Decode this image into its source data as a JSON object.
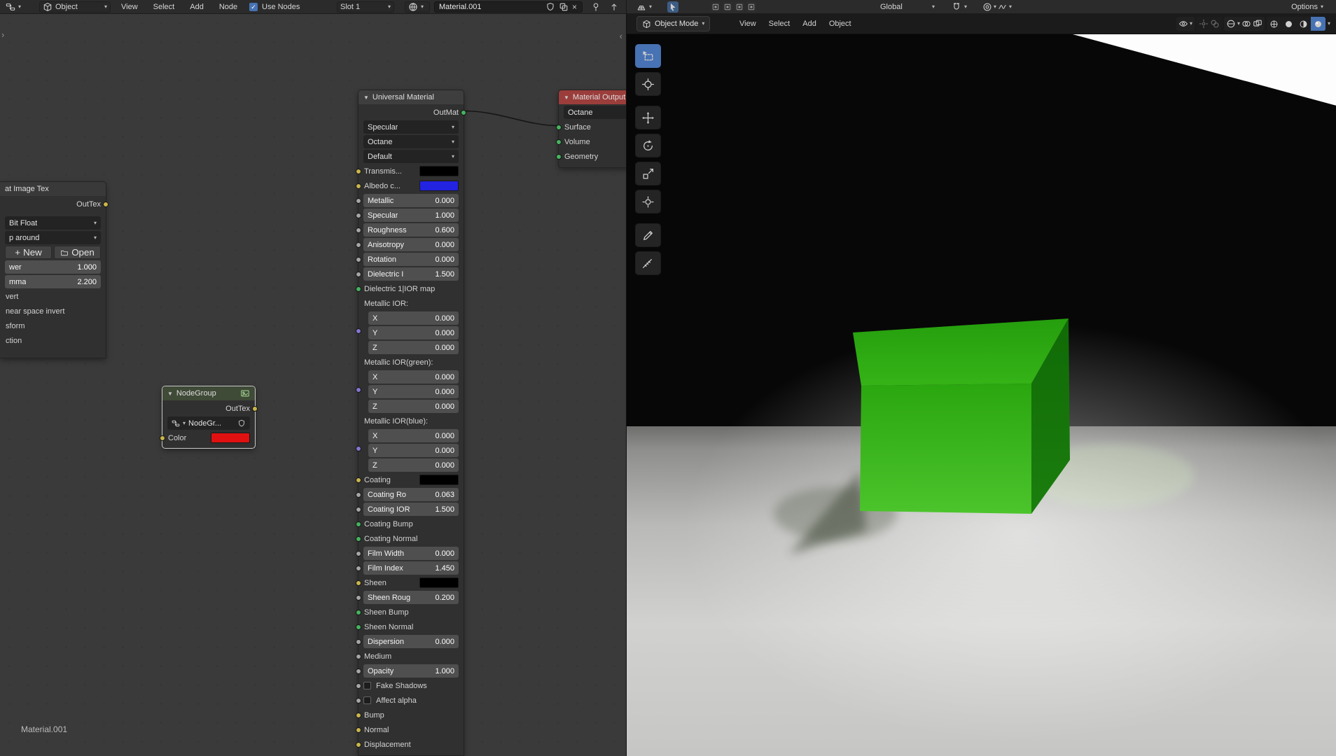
{
  "topbar": {
    "shader_type_label": "Object",
    "menus": [
      "View",
      "Select",
      "Add",
      "Node"
    ],
    "use_nodes_label": "Use Nodes",
    "use_nodes_checked": true,
    "slot_label": "Slot 1",
    "material_name": "Material.001",
    "right": {
      "orientation_label": "Global",
      "options_label": "Options"
    }
  },
  "viewport": {
    "header": {
      "mode_label": "Object Mode",
      "menus": [
        "View",
        "Select",
        "Add",
        "Object"
      ],
      "shading_modes": [
        {
          "name": "wireframe",
          "active": false
        },
        {
          "name": "solid",
          "active": false
        },
        {
          "name": "material-preview",
          "active": false
        },
        {
          "name": "rendered",
          "active": true
        }
      ]
    },
    "tools": [
      {
        "name": "select-box",
        "active": true
      },
      {
        "name": "cursor",
        "active": false
      },
      {
        "name": "move",
        "active": false
      },
      {
        "name": "rotate",
        "active": false
      },
      {
        "name": "scale",
        "active": false
      },
      {
        "name": "transform",
        "active": false
      },
      {
        "name": "annotate",
        "active": false
      },
      {
        "name": "measure",
        "active": false
      }
    ],
    "scene": {
      "object": "green-cube",
      "object_color": "#35b117",
      "floor_color": "#c9c9c7",
      "light_color": "#fdfdfd"
    }
  },
  "node_editor": {
    "tree_path_label": "Material.001",
    "nodes": {
      "image_tex": {
        "title": "at Image Tex",
        "output_label": "OutTex",
        "rows": [
          {
            "kind": "dropdown",
            "label": "Bit Float"
          },
          {
            "kind": "dropdown",
            "label": "p around"
          },
          {
            "kind": "buttons",
            "labels": [
              "New",
              "Open"
            ]
          },
          {
            "kind": "slider",
            "label": "wer",
            "value": "1.000"
          },
          {
            "kind": "slider",
            "label": "mma",
            "value": "2.200"
          },
          {
            "kind": "label",
            "label": "vert"
          },
          {
            "kind": "label",
            "label": "near space invert"
          },
          {
            "kind": "label",
            "label": "sform"
          },
          {
            "kind": "label",
            "label": "ction"
          }
        ]
      },
      "node_group": {
        "title": "NodeGroup",
        "output_label": "OutTex",
        "datablock_label": "NodeGr...",
        "color_label": "Color",
        "color_value": "#e11111"
      },
      "universal_material": {
        "title": "Universal Material",
        "output_label": "OutMat",
        "rows": [
          {
            "kind": "dropdown",
            "label": "Specular"
          },
          {
            "kind": "dropdown",
            "label": "Octane"
          },
          {
            "kind": "dropdown",
            "label": "Default"
          },
          {
            "kind": "color",
            "label": "Transmis...",
            "swatch": "#000000",
            "socket": "yellow"
          },
          {
            "kind": "color",
            "label": "Albedo c...",
            "swatch": "#2323e2",
            "socket": "yellow"
          },
          {
            "kind": "slider",
            "label": "Metallic",
            "value": "0.000",
            "socket": "gray"
          },
          {
            "kind": "slider",
            "label": "Specular",
            "value": "1.000",
            "socket": "gray"
          },
          {
            "kind": "slider",
            "label": "Roughness",
            "value": "0.600",
            "socket": "gray"
          },
          {
            "kind": "slider",
            "label": "Anisotropy",
            "value": "0.000",
            "socket": "gray"
          },
          {
            "kind": "slider",
            "label": "Rotation",
            "value": "0.000",
            "socket": "gray"
          },
          {
            "kind": "slider",
            "label": "Dielectric I",
            "value": "1.500",
            "socket": "gray"
          },
          {
            "kind": "label",
            "label": "Dielectric 1|IOR map",
            "socket": "green"
          },
          {
            "kind": "vector",
            "label": "Metallic IOR:",
            "socket": "purple",
            "components": [
              {
                "label": "X",
                "value": "0.000"
              },
              {
                "label": "Y",
                "value": "0.000"
              },
              {
                "label": "Z",
                "value": "0.000"
              }
            ]
          },
          {
            "kind": "vector",
            "label": "Metallic IOR(green):",
            "socket": "purple",
            "components": [
              {
                "label": "X",
                "value": "0.000"
              },
              {
                "label": "Y",
                "value": "0.000"
              },
              {
                "label": "Z",
                "value": "0.000"
              }
            ]
          },
          {
            "kind": "vector",
            "label": "Metallic IOR(blue):",
            "socket": "purple",
            "components": [
              {
                "label": "X",
                "value": "0.000"
              },
              {
                "label": "Y",
                "value": "0.000"
              },
              {
                "label": "Z",
                "value": "0.000"
              }
            ]
          },
          {
            "kind": "color",
            "label": "Coating",
            "swatch": "#000000",
            "socket": "yellow"
          },
          {
            "kind": "slider",
            "label": "Coating Ro",
            "value": "0.063",
            "socket": "gray"
          },
          {
            "kind": "slider",
            "label": "Coating IOR",
            "value": "1.500",
            "socket": "gray"
          },
          {
            "kind": "label",
            "label": "Coating Bump",
            "socket": "green"
          },
          {
            "kind": "label",
            "label": "Coating Normal",
            "socket": "green"
          },
          {
            "kind": "slider",
            "label": "Film Width",
            "value": "0.000",
            "socket": "gray"
          },
          {
            "kind": "slider",
            "label": "Film Index",
            "value": "1.450",
            "socket": "gray"
          },
          {
            "kind": "color",
            "label": "Sheen",
            "swatch": "#000000",
            "socket": "yellow"
          },
          {
            "kind": "slider",
            "label": "Sheen Roug",
            "value": "0.200",
            "socket": "gray"
          },
          {
            "kind": "label",
            "label": "Sheen Bump",
            "socket": "green"
          },
          {
            "kind": "label",
            "label": "Sheen Normal",
            "socket": "green"
          },
          {
            "kind": "slider",
            "label": "Dispersion",
            "value": "0.000",
            "socket": "gray"
          },
          {
            "kind": "label",
            "label": "Medium",
            "socket": "gray"
          },
          {
            "kind": "slider",
            "label": "Opacity",
            "value": "1.000",
            "socket": "gray"
          },
          {
            "kind": "checkbox",
            "label": "Fake Shadows",
            "checked": false,
            "socket": "gray"
          },
          {
            "kind": "checkbox",
            "label": "Affect alpha",
            "checked": false,
            "socket": "gray"
          },
          {
            "kind": "label",
            "label": "Bump",
            "socket": "yellow"
          },
          {
            "kind": "label",
            "label": "Normal",
            "socket": "yellow"
          },
          {
            "kind": "label",
            "label": "Displacement",
            "socket": "yellow"
          }
        ]
      },
      "material_output": {
        "title": "Material Output",
        "dropdown_label": "Octane",
        "inputs": [
          {
            "label": "Surface",
            "socket": "green"
          },
          {
            "label": "Volume",
            "socket": "green"
          },
          {
            "label": "Geometry",
            "socket": "green"
          }
        ]
      }
    }
  },
  "socket_colors": {
    "yellow": "#c8b54c",
    "green": "#46b35f",
    "gray": "#a5a5a5",
    "purple": "#8276cf"
  }
}
